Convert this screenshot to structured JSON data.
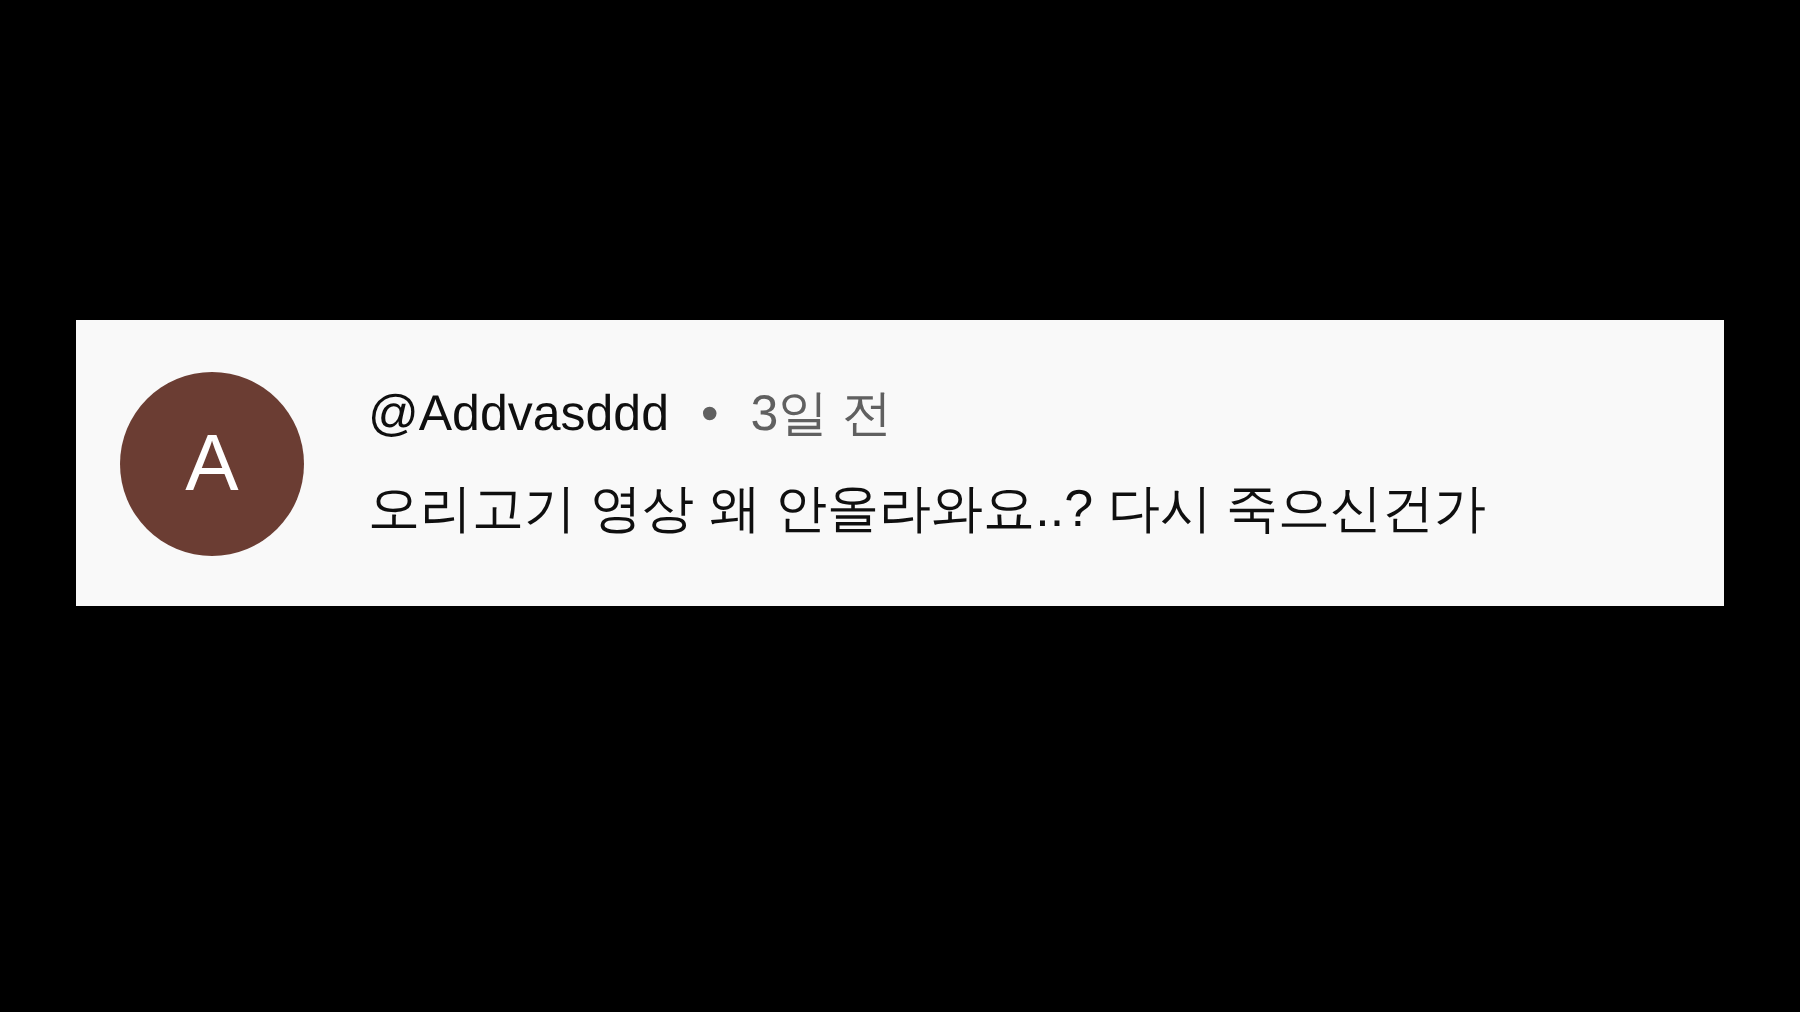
{
  "comment": {
    "avatar_letter": "A",
    "author": "@Addvasddd",
    "separator": "•",
    "time": "3일 전",
    "text": "오리고기 영상 왜 안올라와요..? 다시 죽으신건가"
  }
}
